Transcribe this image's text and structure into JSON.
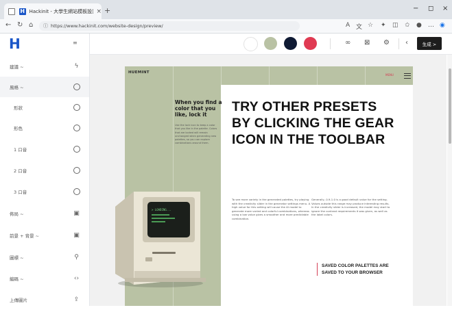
{
  "browser": {
    "tab_title": "Hackinit - 大學生網站模板設計 | ...",
    "tab_close": "×",
    "new_tab": "+",
    "url": "https://www.hackinit.com/website-design/preview/",
    "window_controls": [
      "−",
      "◻",
      "×"
    ]
  },
  "app": {
    "logo": "H",
    "sidebar": {
      "collapse_label": "≡",
      "items": [
        {
          "label": "建議 ~",
          "icon": "lightning-icon"
        },
        {
          "label": "風格 ~",
          "icon": "compass-icon"
        },
        {
          "label": "形狀",
          "icon": "compass-icon"
        },
        {
          "label": "形色",
          "icon": "compass-icon"
        },
        {
          "label": "1 口音",
          "icon": "compass-icon"
        },
        {
          "label": "2 口音",
          "icon": "compass-icon"
        },
        {
          "label": "3 口音",
          "icon": "compass-icon"
        },
        {
          "label": "佈局 ~",
          "icon": "image-icon"
        },
        {
          "label": "前景 + 背景 ~",
          "icon": "image-icon"
        },
        {
          "label": "圖標 ~",
          "icon": "stamp-icon"
        },
        {
          "label": "編碼 ~",
          "icon": "code-icon"
        },
        {
          "label": "上傳圖片",
          "icon": "upload-icon"
        }
      ]
    },
    "toolbar": {
      "swatches": [
        "#ffffff",
        "#b9c2a4",
        "#0f1a33",
        "#e03a52"
      ],
      "save_label": "生成 >"
    }
  },
  "preview": {
    "brand": "HUEMINT",
    "menu_hint": "MENU",
    "hint_title": "When you find a color that you like, lock it",
    "hint_body": "Use the lock icon to keep a color that you like in the palette. Colors that are locked will remain unchanged when generating new palettes, so you can explore combinations around them.",
    "headline": "TRY OTHER PRESETS BY CLICKING THE GEAR ICON IN THE TOOLBAR",
    "body_left": "To see more variety in the generated palettes, try playing with the creativity slider in the generator settings menu. A high value for this setting will cause the AI model to generate more varied and colorful combinations, whereas using a low value gives a smoother and more predictable combination.",
    "body_right": "Generally, 0.9-1.0 is a good default value for the setting. Values outside this range may produce interesting results. In the creativity slider is increased, the model may start to ignore the contrast requirements it was given, as well as the label colors.",
    "saved_note": "SAVED COLOR PALETTES ARE SAVED TO YOUR BROWSER",
    "screen_text": "> LOADING..."
  }
}
